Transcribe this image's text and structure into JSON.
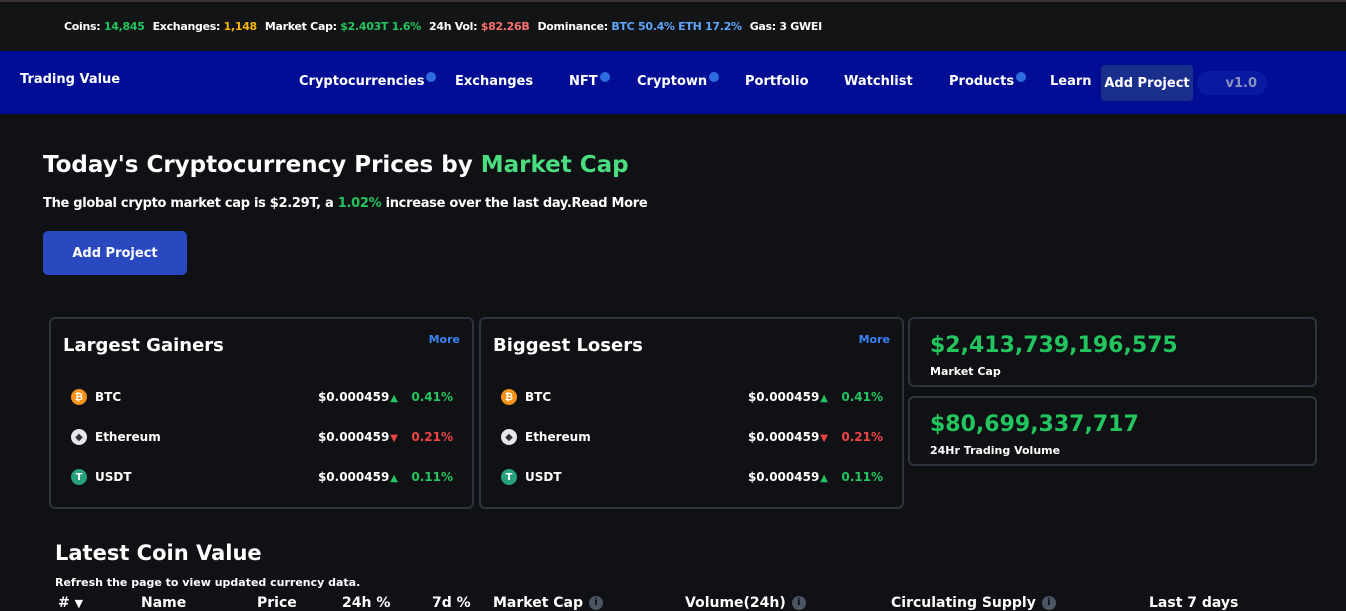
{
  "stats_bar": {
    "coins_label": "Coins:",
    "coins": "14,845",
    "exchanges_label": "Exchanges:",
    "exchanges": "1,148",
    "market_cap_label": "Market Cap:",
    "market_cap": "$2.403T 1.6%",
    "vol_label": "24h Vol:",
    "vol": "$82.26B",
    "dominance_label": "Dominance:",
    "dominance": "BTC 50.4% ETH 17.2%",
    "gas_label": "Gas:",
    "gas": "3 GWEI",
    "colors": {
      "green": "#22c55e",
      "yellow": "#f5b50a",
      "pink": "#f87171",
      "blue": "#60a5fa"
    }
  },
  "navbar": {
    "brand": "Trading Value",
    "items": [
      {
        "label": "Cryptocurrencies",
        "has_dot": true
      },
      {
        "label": "Exchanges",
        "has_dot": false
      },
      {
        "label": "NFT",
        "has_dot": true
      },
      {
        "label": "Cryptown",
        "has_dot": true
      },
      {
        "label": "Portfolio",
        "has_dot": false
      },
      {
        "label": "Watchlist",
        "has_dot": false
      },
      {
        "label": "Products",
        "has_dot": true
      },
      {
        "label": "Learn",
        "has_dot": false
      }
    ],
    "add_project": "Add Project",
    "version": "v1.0",
    "background": "#020d96"
  },
  "hero": {
    "title_prefix": "Today's Cryptocurrency Prices by",
    "title_accent": "Market Cap",
    "subtitle_prefix": "The global crypto market cap is $2.29T, a",
    "subtitle_change": "1.02%",
    "subtitle_suffix": "increase over the last day.Read More",
    "button": "Add Project"
  },
  "gainers": {
    "title": "Largest Gainers",
    "more": "More",
    "rows": [
      {
        "name": "BTC",
        "icon": "bitcoin-icon",
        "price": "$0.000459",
        "dir": "up",
        "change": "0.41%"
      },
      {
        "name": "Ethereum",
        "icon": "ethereum-icon",
        "price": "$0.000459",
        "dir": "down",
        "change": "0.21%"
      },
      {
        "name": "USDT",
        "icon": "tether-icon",
        "price": "$0.000459",
        "dir": "up",
        "change": "0.11%"
      }
    ]
  },
  "losers": {
    "title": "Biggest Losers",
    "more": "More",
    "rows": [
      {
        "name": "BTC",
        "icon": "bitcoin-icon",
        "price": "$0.000459",
        "dir": "up",
        "change": "0.41%"
      },
      {
        "name": "Ethereum",
        "icon": "ethereum-icon",
        "price": "$0.000459",
        "dir": "down",
        "change": "0.21%"
      },
      {
        "name": "USDT",
        "icon": "tether-icon",
        "price": "$0.000459",
        "dir": "up",
        "change": "0.11%"
      }
    ]
  },
  "market_cap_card": {
    "value": "$2,413,739,196,575",
    "label": "Market Cap"
  },
  "volume_card": {
    "value": "$80,699,337,717",
    "label": "24Hr Trading Volume"
  },
  "latest": {
    "title": "Latest Coin Value",
    "subtitle": "Refresh the page to view updated currency data.",
    "columns": {
      "rank": "#",
      "name": "Name",
      "price": "Price",
      "change_24h": "24h %",
      "change_7d": "7d %",
      "market_cap": "Market Cap",
      "volume": "Volume(24h)",
      "supply": "Circulating Supply",
      "last7": "Last 7 days"
    }
  }
}
